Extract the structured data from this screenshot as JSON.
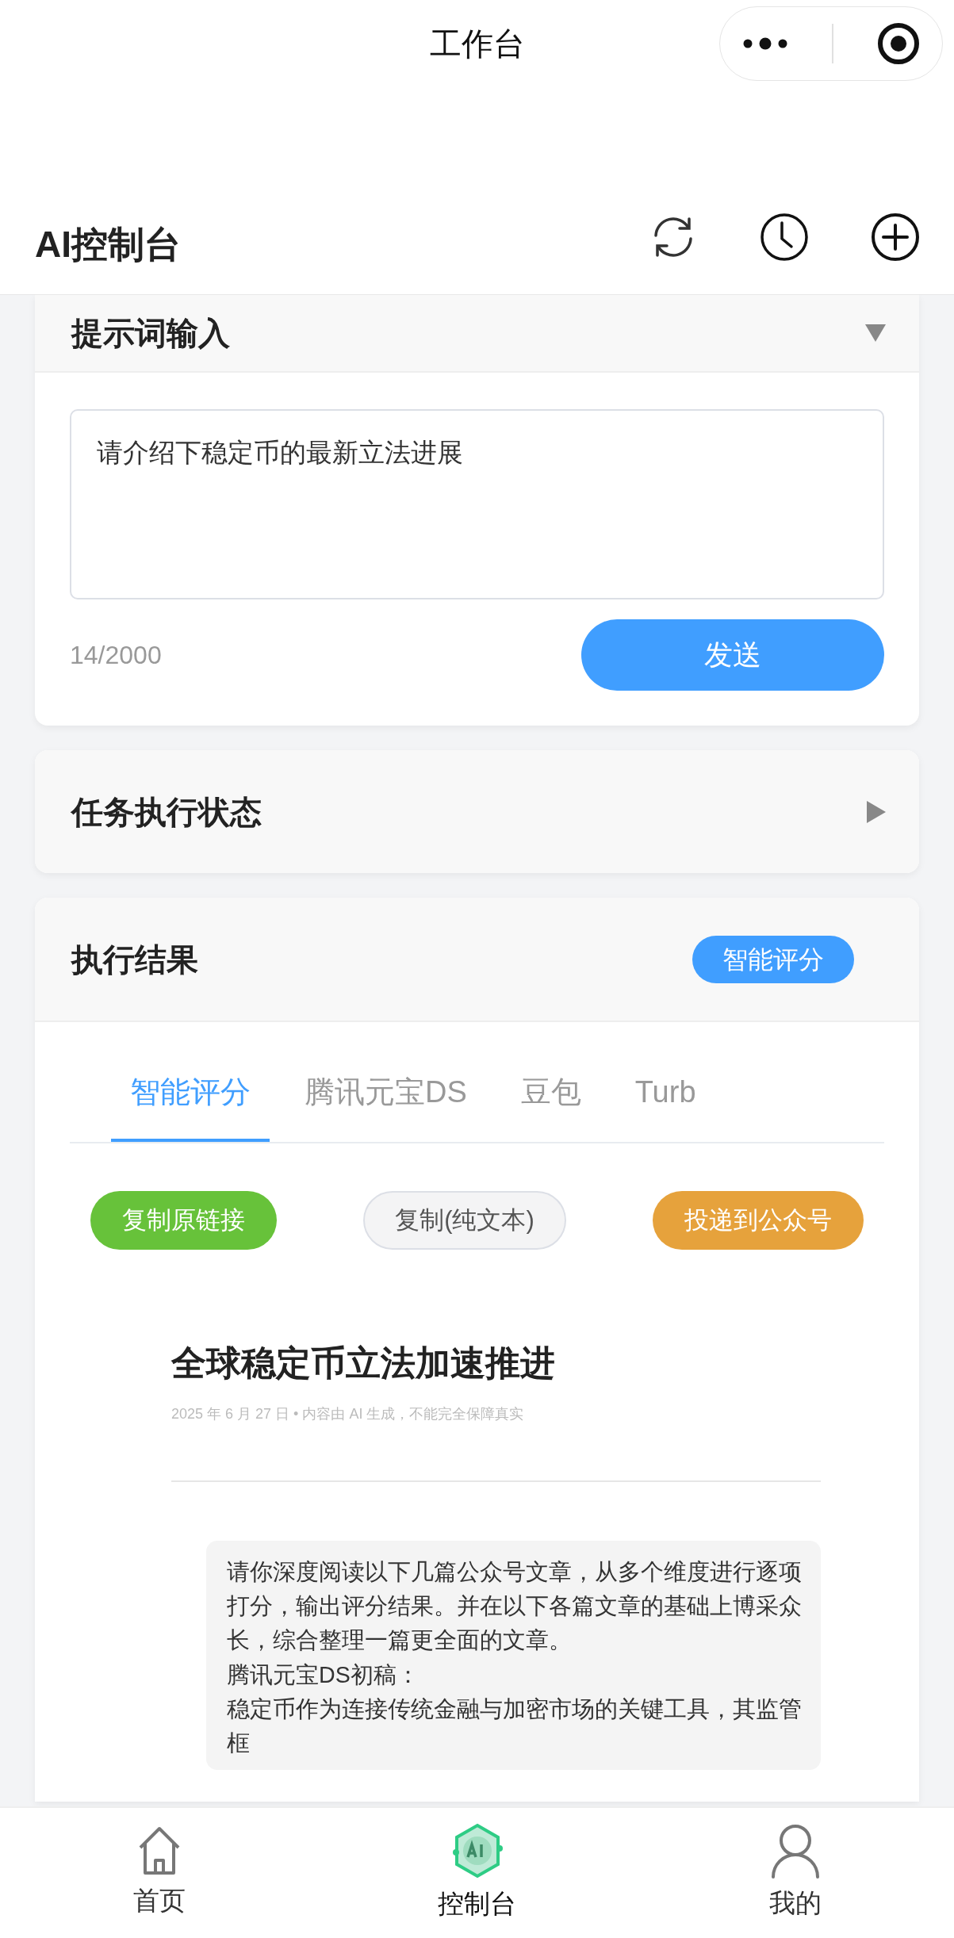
{
  "mini_program_bar": {
    "title": "工作台"
  },
  "header": {
    "title": "AI控制台"
  },
  "prompt_panel": {
    "title": "提示词输入",
    "expanded": true,
    "prompt": "请介绍下稳定币的最新立法进展",
    "counter": "14/2000",
    "send_button": "发送"
  },
  "status_panel": {
    "title": "任务执行状态",
    "expanded": false
  },
  "result_panel": {
    "title": "执行结果",
    "badge": "智能评分",
    "tabs": [
      {
        "label": "智能评分",
        "selected": true
      },
      {
        "label": "腾讯元宝DS",
        "selected": false
      },
      {
        "label": "豆包",
        "selected": false
      },
      {
        "label": "Turb",
        "selected": false
      }
    ],
    "actions": [
      {
        "label": "复制原链接",
        "kind": "success"
      },
      {
        "label": "复制(纯文本)",
        "kind": "plain"
      },
      {
        "label": "投递到公众号",
        "kind": "warning"
      }
    ],
    "article": {
      "title": "全球稳定币立法加速推进",
      "meta": "2025 年 6 月 27 日 • 内容由 AI 生成，不能完全保障真实",
      "quote": [
        "请你深度阅读以下几篇公众号文章，从多个维度进行逐项打分，输出评分结果。并在以下各篇文章的基础上博采众长，综合整理一篇更全面的文章。",
        "腾讯元宝DS初稿：",
        "稳定币作为连接传统金融与加密市场的关键工具，其监管框"
      ]
    }
  },
  "tab_bar": [
    {
      "label": "首页",
      "kind": "home",
      "selected": false
    },
    {
      "label": "控制台",
      "kind": "ai",
      "selected": true
    },
    {
      "label": "我的",
      "kind": "user",
      "selected": false
    }
  ]
}
